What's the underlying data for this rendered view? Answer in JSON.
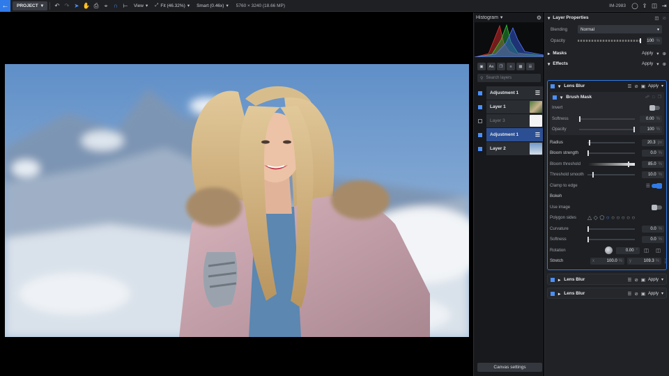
{
  "toolbar": {
    "project_label": "PROJECT",
    "view_label": "View",
    "fit_label": "Fit (46.32%)",
    "smart_label": "Smart (0.46x)",
    "image_info": "5760 × 3240 (18.66 MP)",
    "image_id": "IM-2983"
  },
  "histogram": {
    "title": "Histogram"
  },
  "layers_panel": {
    "search_placeholder": "Search layers",
    "layers": [
      {
        "name": "Adjustment 1",
        "visible": true,
        "selected": false,
        "kind": "adjustment"
      },
      {
        "name": "Layer 1",
        "visible": true,
        "selected": false,
        "kind": "image"
      },
      {
        "name": "Layer 3",
        "visible": false,
        "selected": false,
        "kind": "white"
      },
      {
        "name": "Adjustment 1",
        "visible": true,
        "selected": true,
        "kind": "adjustment"
      },
      {
        "name": "Layer 2",
        "visible": true,
        "selected": false,
        "kind": "image"
      }
    ],
    "canvas_settings_label": "Canvas settings"
  },
  "properties": {
    "title": "Layer Properties",
    "blending_label": "Blending",
    "blending_value": "Normal",
    "opacity_label": "Opacity",
    "opacity_value": "100",
    "percent": "%",
    "masks_label": "Masks",
    "effects_label": "Effects",
    "apply_label": "Apply",
    "lens_blur": {
      "title": "Lens Blur",
      "apply_label": "Apply",
      "brush_mask": {
        "title": "Brush Mask",
        "invert_label": "Invert",
        "softness_label": "Softness",
        "softness_value": "0.00",
        "opacity_label": "Opacity",
        "opacity_value": "100"
      },
      "radius_label": "Radius",
      "radius_value": "20.3",
      "radius_unit": "px",
      "bloom_strength_label": "Bloom strength",
      "bloom_strength_value": "0.0",
      "bloom_threshold_label": "Bloom threshold",
      "bloom_threshold_value": "85.0",
      "threshold_smooth_label": "Threshold smooth",
      "threshold_smooth_value": "10.0",
      "clamp_label": "Clamp to edge",
      "bokeh_label": "Bokeh",
      "use_image_label": "Use image",
      "polygon_sides_label": "Polygon sides",
      "curvature_label": "Curvature",
      "curvature_value": "0.0",
      "softness_label": "Softness",
      "softness_value": "0.0",
      "rotation_label": "Rotation",
      "rotation_value": "0.00",
      "rotation_unit": "°",
      "stretch_label": "Stretch",
      "stretch_x_axis": "x",
      "stretch_x_value": "100.0",
      "stretch_y_axis": "y",
      "stretch_y_value": "109.3"
    },
    "collapsed_effects": [
      {
        "title": "Lens Blur",
        "apply_label": "Apply"
      },
      {
        "title": "Lens Blur",
        "apply_label": "Apply"
      }
    ]
  }
}
